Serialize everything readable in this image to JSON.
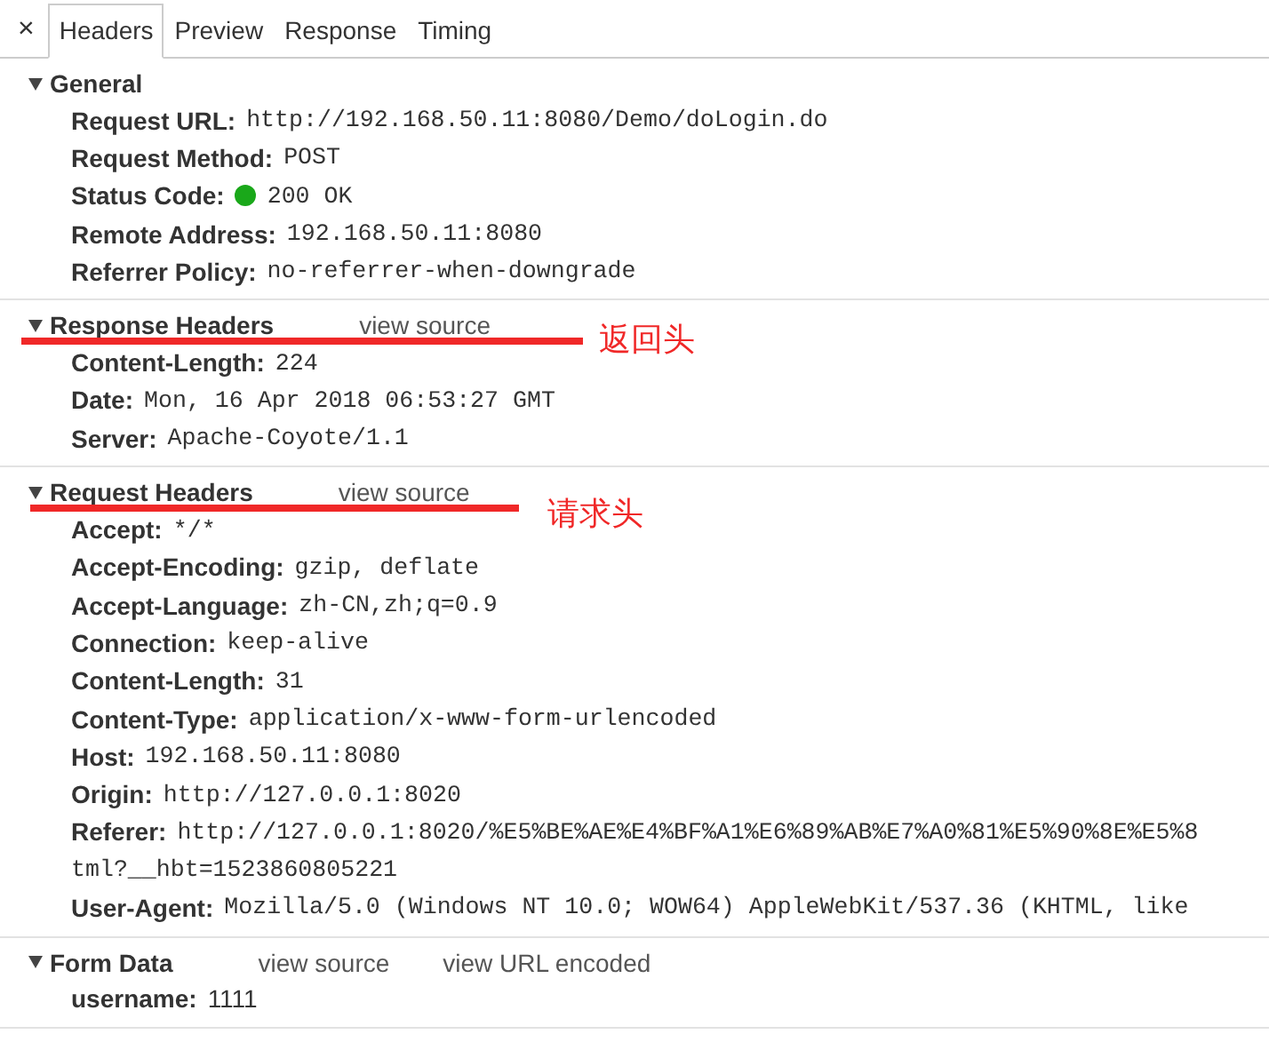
{
  "close_label": "×",
  "tabs": [
    {
      "label": "Headers",
      "selected": true
    },
    {
      "label": "Preview",
      "selected": false
    },
    {
      "label": "Response",
      "selected": false
    },
    {
      "label": "Timing",
      "selected": false
    }
  ],
  "sections": [
    {
      "title": "General",
      "expanded": true,
      "rows": [
        {
          "kind": "header",
          "name": "Request URL:",
          "value": "http://192.168.50.11:8080/Demo/doLogin.do"
        },
        {
          "kind": "header",
          "name": "Request Method:",
          "value": "POST"
        },
        {
          "kind": "status",
          "name": "Status Code:",
          "value": "200 OK",
          "color": "#1aa81a"
        },
        {
          "kind": "header",
          "name": "Remote Address:",
          "value": "192.168.50.11:8080"
        },
        {
          "kind": "header",
          "name": "Referrer Policy:",
          "value": "no-referrer-when-downgrade"
        }
      ]
    },
    {
      "title": "Response Headers",
      "expanded": true,
      "links": [
        "view source"
      ],
      "annotation": "返回头",
      "rows": [
        {
          "kind": "header",
          "name": "Content-Length:",
          "value": "224"
        },
        {
          "kind": "header",
          "name": "Date:",
          "value": "Mon, 16 Apr 2018 06:53:27 GMT"
        },
        {
          "kind": "header",
          "name": "Server:",
          "value": "Apache-Coyote/1.1"
        }
      ]
    },
    {
      "title": "Request Headers",
      "expanded": true,
      "links": [
        "view source"
      ],
      "annotation": "请求头",
      "rows": [
        {
          "kind": "header",
          "name": "Accept:",
          "value": "*/*"
        },
        {
          "kind": "header",
          "name": "Accept-Encoding:",
          "value": "gzip, deflate"
        },
        {
          "kind": "header",
          "name": "Accept-Language:",
          "value": "zh-CN,zh;q=0.9"
        },
        {
          "kind": "header",
          "name": "Connection:",
          "value": "keep-alive"
        },
        {
          "kind": "header",
          "name": "Content-Length:",
          "value": "31"
        },
        {
          "kind": "header",
          "name": "Content-Type:",
          "value": "application/x-www-form-urlencoded"
        },
        {
          "kind": "header",
          "name": "Host:",
          "value": "192.168.50.11:8080"
        },
        {
          "kind": "header",
          "name": "Origin:",
          "value": "http://127.0.0.1:8020"
        },
        {
          "kind": "header",
          "name": "Referer:",
          "value": "http://127.0.0.1:8020/%E5%BE%AE%E4%BF%A1%E6%89%AB%E7%A0%81%E5%90%8E%E5%8",
          "continuation": "tml?__hbt=1523860805221"
        },
        {
          "kind": "header",
          "name": "User-Agent:",
          "value": "Mozilla/5.0 (Windows NT 10.0; WOW64) AppleWebKit/537.36 (KHTML, like"
        }
      ]
    },
    {
      "title": "Form Data",
      "expanded": true,
      "links": [
        "view source",
        "view URL encoded"
      ],
      "rows": [
        {
          "kind": "form",
          "name": "username:",
          "value": "1111"
        }
      ]
    }
  ]
}
